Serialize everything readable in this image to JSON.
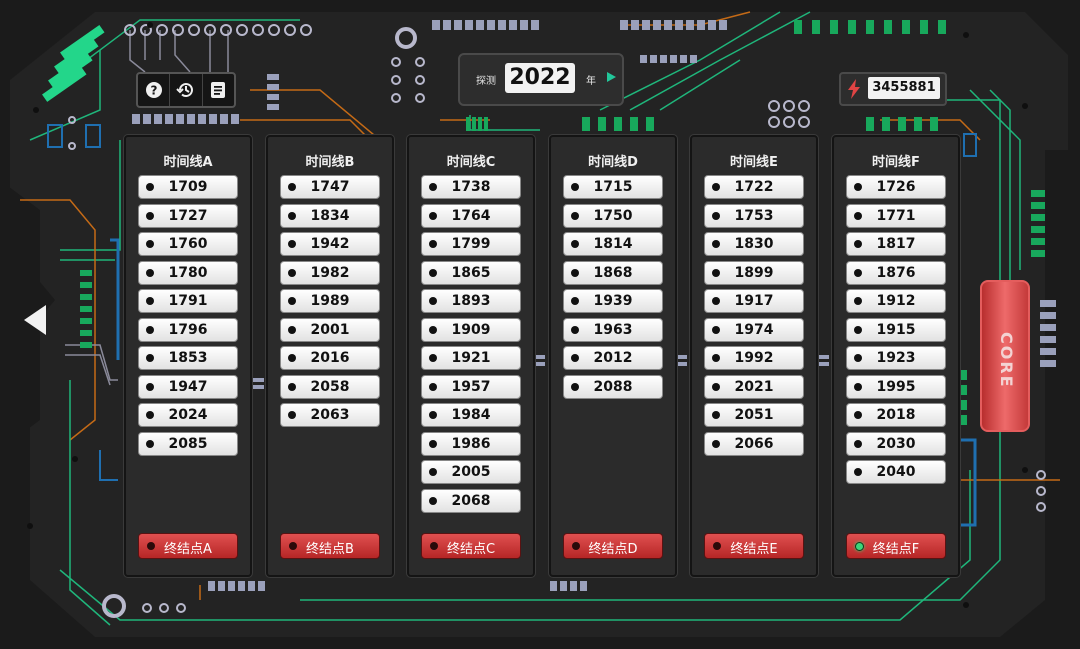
{
  "toolbar": {
    "help_icon": "help-icon",
    "history_icon": "history-icon",
    "log_icon": "document-icon"
  },
  "probe": {
    "label": "探测",
    "year": "2022",
    "unit": "年"
  },
  "energy": {
    "icon": "lightning-icon",
    "value": "3455881"
  },
  "core": {
    "label": "CORE"
  },
  "colors": {
    "board": "#232323",
    "trace_green": "#1fb67b",
    "trace_orange": "#c46a16",
    "trace_blue": "#1f6fb0",
    "endpoint_red": "#cc3a3a",
    "active_dot": "#3bd67a"
  },
  "timelines": [
    {
      "title": "时间线A",
      "years": [
        "1709",
        "1727",
        "1760",
        "1780",
        "1791",
        "1796",
        "1853",
        "1947",
        "2024",
        "2085"
      ],
      "endpoint": "终结点A",
      "endpoint_active": false
    },
    {
      "title": "时间线B",
      "years": [
        "1747",
        "1834",
        "1942",
        "1982",
        "1989",
        "2001",
        "2016",
        "2058",
        "2063"
      ],
      "endpoint": "终结点B",
      "endpoint_active": false
    },
    {
      "title": "时间线C",
      "years": [
        "1738",
        "1764",
        "1799",
        "1865",
        "1893",
        "1909",
        "1921",
        "1957",
        "1984",
        "1986",
        "2005",
        "2068"
      ],
      "endpoint": "终结点C",
      "endpoint_active": false
    },
    {
      "title": "时间线D",
      "years": [
        "1715",
        "1750",
        "1814",
        "1868",
        "1939",
        "1963",
        "2012",
        "2088"
      ],
      "endpoint": "终结点D",
      "endpoint_active": false
    },
    {
      "title": "时间线E",
      "years": [
        "1722",
        "1753",
        "1830",
        "1899",
        "1917",
        "1974",
        "1992",
        "2021",
        "2051",
        "2066"
      ],
      "endpoint": "终结点E",
      "endpoint_active": false
    },
    {
      "title": "时间线F",
      "years": [
        "1726",
        "1771",
        "1817",
        "1876",
        "1912",
        "1915",
        "1923",
        "1995",
        "2018",
        "2030",
        "2040"
      ],
      "endpoint": "终结点F",
      "endpoint_active": true
    }
  ]
}
